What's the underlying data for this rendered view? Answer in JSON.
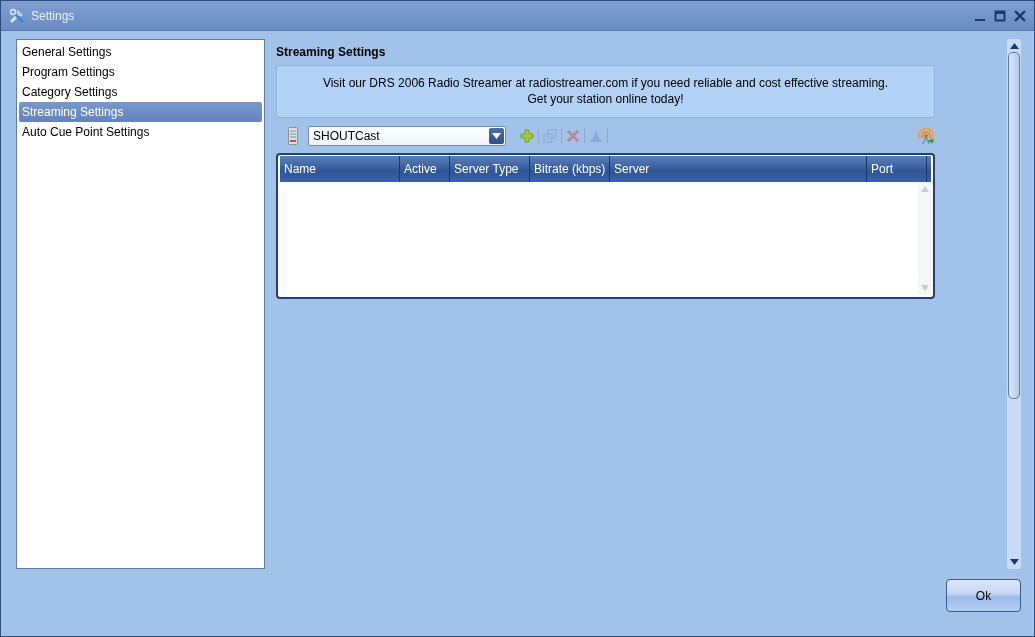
{
  "window": {
    "title": "Settings"
  },
  "sidebar": {
    "items": [
      {
        "label": "General Settings",
        "selected": false
      },
      {
        "label": "Program Settings",
        "selected": false
      },
      {
        "label": "Category Settings",
        "selected": false
      },
      {
        "label": "Streaming Settings",
        "selected": true
      },
      {
        "label": "Auto Cue Point Settings",
        "selected": false
      }
    ]
  },
  "section_title": "Streaming Settings",
  "info_box": {
    "lines": [
      "Visit our DRS 2006 Radio Streamer at radiostreamer.com if you need reliable and cost effective streaming.",
      "Get your station online today!"
    ]
  },
  "toolbar": {
    "server_type": {
      "value": "SHOUTCast"
    },
    "tools": [
      {
        "kind": "add",
        "disabled": false
      },
      {
        "kind": "copy",
        "disabled": true
      },
      {
        "kind": "delete",
        "disabled": true
      },
      {
        "kind": "wizard",
        "disabled": true
      }
    ]
  },
  "table": {
    "columns": [
      "Name",
      "Active",
      "Server Type",
      "Bitrate (kbps)",
      "Server",
      "Port"
    ]
  },
  "buttons": [
    "Ok"
  ]
}
